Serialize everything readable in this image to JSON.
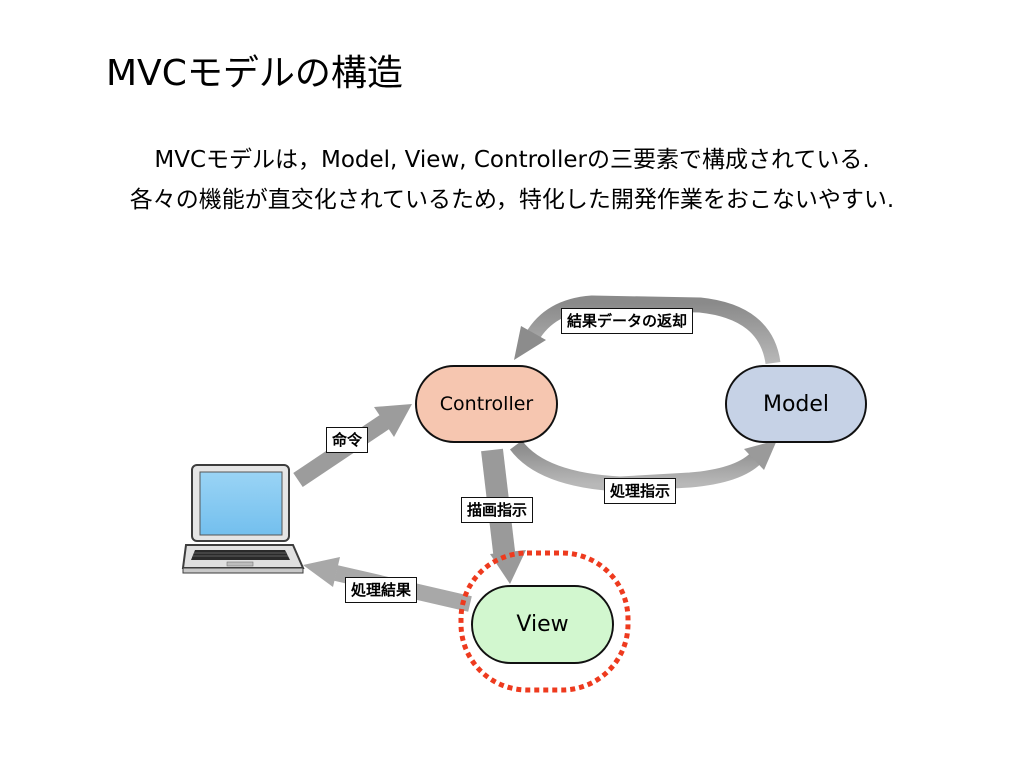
{
  "slide": {
    "title": "MVCモデルの構造",
    "description_lines": [
      "MVCモデルは，Model, View, Controllerの三要素で構成されている.",
      "各々の機能が直交化されているため，特化した開発作業をおこないやすい."
    ]
  },
  "nodes": {
    "controller": "Controller",
    "model": "Model",
    "view": "View"
  },
  "edges": {
    "data_return": "結果データの返却",
    "command": "命令",
    "process_instruction": "処理指示",
    "draw_instruction": "描画指示",
    "process_result": "処理結果"
  },
  "colors": {
    "controller_fill": "#f6c6b0",
    "model_fill": "#c6d2e6",
    "view_fill": "#d2f7cf",
    "arrow": "#9c9c9c",
    "highlight": "#ee3a1e"
  },
  "icons": {
    "client": "laptop-icon"
  }
}
